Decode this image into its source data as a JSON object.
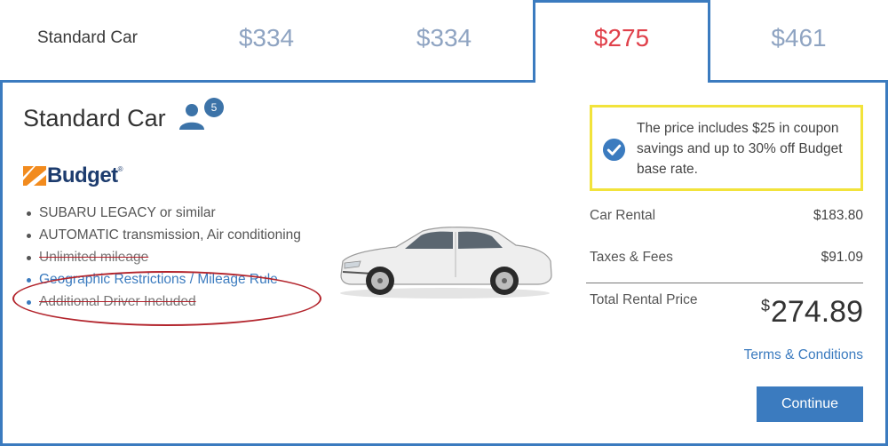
{
  "tabs": {
    "label": "Standard Car",
    "prices": [
      "$334",
      "$334",
      "$275",
      "$461"
    ],
    "selected_index": 2
  },
  "car": {
    "title": "Standard Car",
    "passengers": "5",
    "brand": "Budget",
    "brand_tm": "®",
    "features": [
      "SUBARU LEGACY or similar",
      "AUTOMATIC transmission, Air conditioning",
      "Unlimited mileage",
      "Geographic Restrictions / Mileage Rule",
      "Additional Driver Included"
    ]
  },
  "pricing": {
    "savings_note": "The price includes $25 in coupon savings and up to 30% off Budget base rate.",
    "car_rental_label": "Car Rental",
    "car_rental_value": "$183.80",
    "taxes_label": "Taxes & Fees",
    "taxes_value": "$91.09",
    "total_label": "Total Rental Price",
    "total_currency": "$",
    "total_value": "274.89",
    "terms_label": "Terms & Conditions",
    "continue_label": "Continue"
  },
  "colors": {
    "accent": "#3b7bbf",
    "selected_price": "#e0404a",
    "unselected_price": "#8fa4c2",
    "savings_border": "#f2e33b",
    "annotation_oval": "#b3252d"
  }
}
